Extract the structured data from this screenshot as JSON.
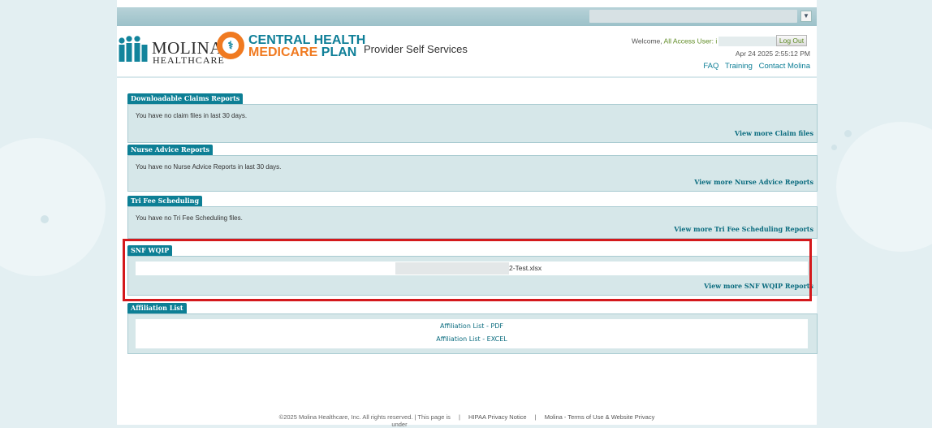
{
  "topbar": {
    "dropdown_icon": "chevron-down-icon"
  },
  "header": {
    "molina_logo": {
      "name": "MOLINA",
      "sub": "HEALTHCARE"
    },
    "central_health_logo": {
      "line1": "CENTRAL HEALTH",
      "line2a": "MEDICARE",
      "line2b": " PLAN"
    },
    "portal_title": "Provider Self Services",
    "welcome_prefix": "Welcome,",
    "welcome_user": "All Access User: i",
    "logout_label": "Log Out",
    "datetime": "Apr 24 2025 2:55:12 PM",
    "links": [
      "FAQ",
      "Training",
      "Contact Molina"
    ]
  },
  "sections": {
    "claims": {
      "tab": "Downloadable Claims Reports",
      "message": "You have no claim files in last 30 days.",
      "link": "View more Claim files"
    },
    "nurse": {
      "tab": "Nurse Advice Reports",
      "message": "You have no Nurse Advice Reports in last 30 days.",
      "link": "View more Nurse Advice Reports"
    },
    "trifee": {
      "tab": "Tri Fee Scheduling",
      "message": "You have no Tri Fee Scheduling files.",
      "link": "View more Tri Fee Scheduling Reports"
    },
    "snf": {
      "tab": "SNF WQIP",
      "file": "2-Test.xlsx",
      "link": "View more SNF WQIP Reports"
    },
    "affiliation": {
      "tab": "Affiliation List",
      "links": [
        "Affiliation List - PDF",
        "Affiliation List - EXCEL"
      ]
    }
  },
  "footer": {
    "copyright": "©2025 Molina Healthcare, Inc. All rights reserved. | This page is",
    "copyright_cont": "under",
    "hipaa": "HIPAA Privacy Notice",
    "terms": "Molina - Terms of Use & Website Privacy"
  },
  "colors": {
    "accent": "#0d7f95",
    "panel_bg": "#d6e7e9",
    "highlight": "#d4191c",
    "orange": "#f07a21"
  }
}
